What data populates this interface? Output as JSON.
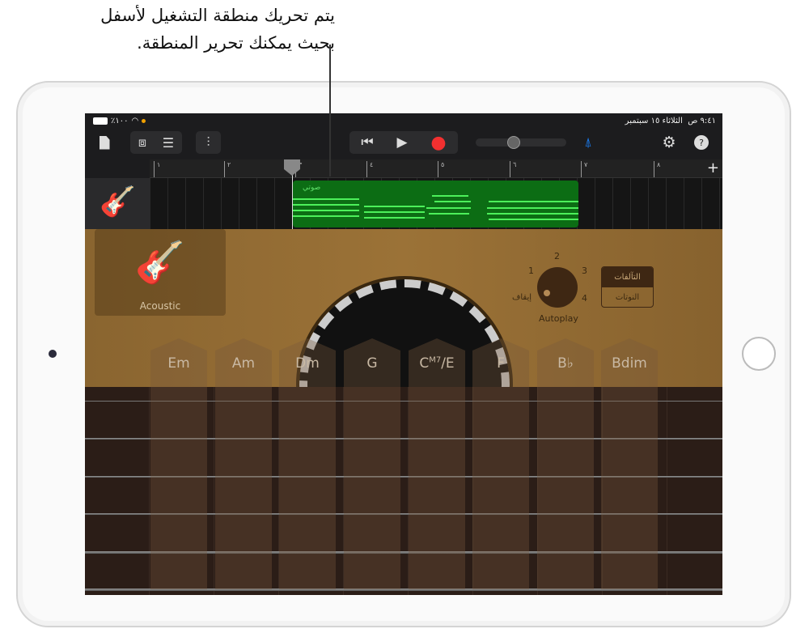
{
  "callout": {
    "line1": "يتم تحريك منطقة التشغيل لأسفل",
    "line2": "بحيث يمكنك تحرير المنطقة."
  },
  "status": {
    "battery": "٪١٠٠",
    "time": "٩:٤١ ص",
    "date": "الثلاثاء ١٥ سبتمبر"
  },
  "toolbar": {
    "my_songs_icon": "document-icon",
    "view_icon": "view-toggle-icon",
    "tracks_icon": "tracks-view-icon",
    "mixer_icon": "mixer-icon",
    "rewind": "⏮",
    "play": "▶",
    "record": "●",
    "metronome_color": "#1a7cf0",
    "settings_icon": "gear-icon",
    "help_icon": "help-icon",
    "add": "+"
  },
  "ruler": [
    "١",
    "٢",
    "٣",
    "٤",
    "٥",
    "٦",
    "٧",
    "٨"
  ],
  "track": {
    "region_name": "صوتي",
    "region_color": "#0c6d14"
  },
  "instrument": {
    "name": "Acoustic"
  },
  "autoplay": {
    "label": "Autoplay",
    "off": "إيقاف",
    "positions": [
      "1",
      "2",
      "3",
      "4"
    ],
    "level": 0
  },
  "mode": {
    "chords": "التآلفات",
    "notes": "النوتات",
    "selected": "chords"
  },
  "chords": [
    "Em",
    "Am",
    "Dm",
    "G",
    "C|M7|/E",
    "F",
    "B♭",
    "Bdim"
  ]
}
